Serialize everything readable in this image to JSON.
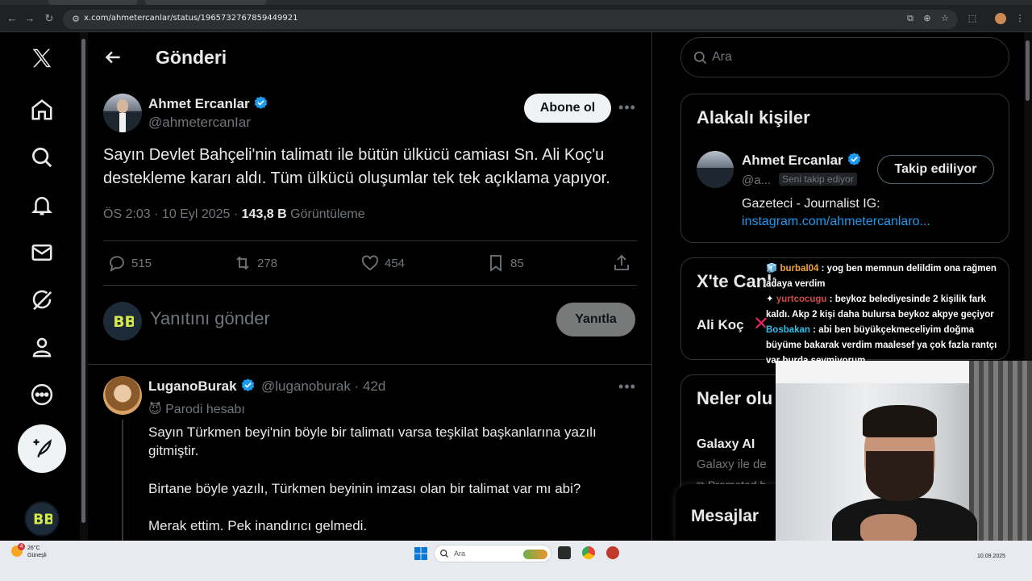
{
  "browser": {
    "url": "x.com/ahmetercanlar/status/1965732767859449921"
  },
  "nav": {
    "post_button_icon": "feather-plus-icon"
  },
  "header": {
    "title": "Gönderi"
  },
  "tweet": {
    "author_name": "Ahmet Ercanlar",
    "author_handle": "@ahmetercanIar",
    "follow_label": "Abone ol",
    "text": "Sayın Devlet Bahçeli'nin talimatı ile bütün ülkücü camiası Sn. Ali Koç'u destekleme kararı aldı. Tüm ülkücü oluşumlar tek tek açıklama yapıyor.",
    "time": "ÖS 2:03 · 10 Eyl 2025 · ",
    "views_count": "143,8 B",
    "views_label": " Görüntüleme",
    "replies": "515",
    "reposts": "278",
    "likes": "454",
    "bookmarks": "85"
  },
  "reply_box": {
    "placeholder": "Yanıtını gönder",
    "button_label": "Yanıtla"
  },
  "comment": {
    "name": "LuganoBurak",
    "handle": "@luganoburak · 42d",
    "parody_label": "😈 Parodi hesabı",
    "line1": "Sayın Türkmen beyi'nin böyle bir talimatı varsa teşkilat başkanlarına yazılı gitmiştir.",
    "line2": "Birtane böyle yazılı, Türkmen beyinin imzası olan bir talimat var mı abi?",
    "line3": "Merak ettim. Pek inandırıcı gelmedi."
  },
  "sidebar": {
    "search_placeholder": "Ara",
    "related_title": "Alakalı kişiler",
    "related_name": "Ahmet Ercanlar",
    "related_handle": "@a...",
    "follows_you": "Seni takip ediyor",
    "following_label": "Takip ediliyor",
    "bio_line1": "Gazeteci - Journalist IG:",
    "bio_link": "instagram.com/ahmetercanlaro...",
    "live_title": "X'te Canlı",
    "live_item": "Ali Koç",
    "trends_title": "Neler olu",
    "trend_name": "Galaxy AI",
    "trend_sub": "Galaxy ile de",
    "trend_promoted": "Promoted b",
    "messages_title": "Mesajlar"
  },
  "chat": [
    {
      "user": "burbal04",
      "text": " : yog ben memnun delildim ona rağmen adaya verdim"
    },
    {
      "user": "yurtcocugu",
      "text": " : beykoz belediyesinde 2 kişilik fark kaldı. Akp 2 kişi daha bulursa beykoz akpye geçiyor"
    },
    {
      "user": "Bosbakan",
      "text": " : abi ben büyükçekmeceliyim doğma büyüme bakarak verdim maalesef ya çok fazla rantçı var burda sevmiyorum"
    }
  ],
  "taskbar": {
    "temp": "26°C",
    "weather": "Güneşli",
    "badge": "4",
    "search": "Ara",
    "date": "10.09.2025"
  }
}
